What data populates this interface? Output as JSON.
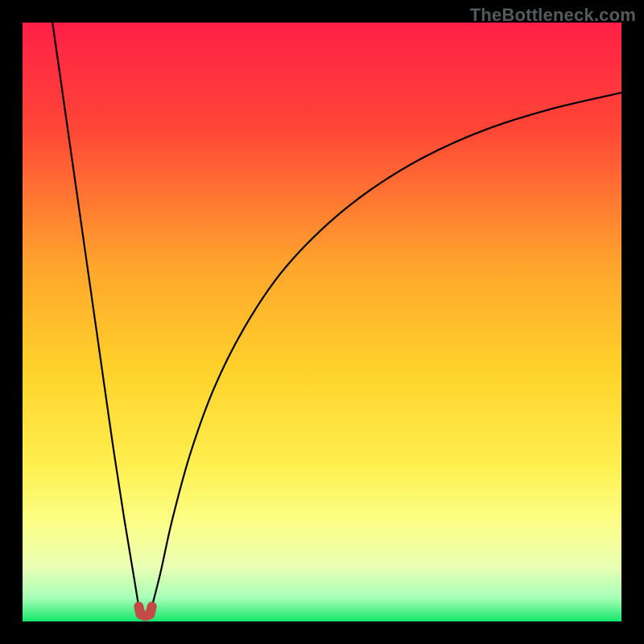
{
  "watermark": "TheBottleneck.com",
  "chart_data": {
    "type": "line",
    "title": "",
    "xlabel": "",
    "ylabel": "",
    "xlim": [
      0,
      100
    ],
    "ylim": [
      0,
      100
    ],
    "grid": false,
    "legend": false,
    "annotations": [],
    "background_gradient": {
      "top": "#ff1f47",
      "mid1": "#ff7a2e",
      "mid2": "#ffcf2a",
      "mid3": "#fff45a",
      "mid4": "#e6ffb0",
      "bottom": "#15e86b"
    },
    "series": [
      {
        "name": "left-branch",
        "x": [
          5,
          7,
          9,
          11,
          13,
          15,
          17,
          18.5,
          19.4
        ],
        "y": [
          100,
          86,
          72,
          58,
          44,
          30,
          17,
          8,
          2.5
        ]
      },
      {
        "name": "right-branch",
        "x": [
          21.6,
          23,
          25,
          28,
          32,
          37,
          43,
          50,
          58,
          67,
          77,
          88,
          100
        ],
        "y": [
          2.5,
          8,
          17,
          28,
          39,
          49,
          58,
          65.5,
          72,
          77.5,
          82,
          85.5,
          88.3
        ]
      },
      {
        "name": "valley-marker",
        "x": [
          19.4,
          19.7,
          20.5,
          21.3,
          21.6
        ],
        "y": [
          2.5,
          1.2,
          0.9,
          1.2,
          2.5
        ],
        "style": "thick-red"
      }
    ]
  }
}
